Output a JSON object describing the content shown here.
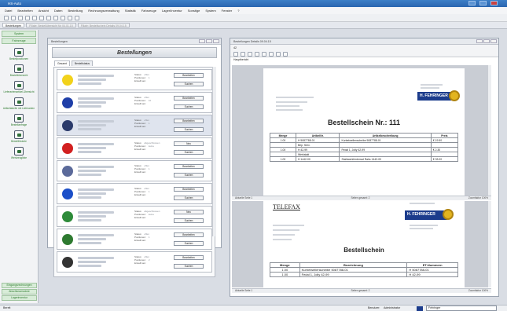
{
  "app": {
    "title": "HS-Auto"
  },
  "menu": [
    "Datei",
    "Bearbeiten",
    "Ansicht",
    "Daten",
    "Bestellung",
    "Rechnungsverwaltung",
    "Statistik",
    "Fahrzeuge",
    "Lager/Inventur",
    "Sonstige",
    "System",
    "Fenster",
    "?"
  ],
  "tabs": [
    {
      "label": "Bestellungen"
    },
    {
      "label": "Filiale: Bestellübersicht für 04.01.15"
    },
    {
      "label": "Filiale: Bestellschein Details 09.04.15"
    }
  ],
  "sidebar": {
    "header_top": "System",
    "header_second": "Fahrzeuge",
    "items": [
      {
        "label": "Bestellpositionen",
        "icon": "list-icon"
      },
      {
        "label": "Bestellübersicht",
        "icon": "clock-icon"
      },
      {
        "label": "Lieferantenartikel-Übersicht",
        "icon": "document-icon"
      },
      {
        "label": "Artikeltabelle mit Lieferanten",
        "icon": "tools-icon"
      },
      {
        "label": "Bestellanfrage",
        "icon": "globe-icon"
      },
      {
        "label": "Bestellhistorie",
        "icon": "tools-icon"
      },
      {
        "label": "Werkzeugliste",
        "icon": "gear-icon"
      }
    ],
    "bottom": [
      "Eingangsrechnungen",
      "Abschlussmodule",
      "Lagerinventur"
    ]
  },
  "bestellungen_window": {
    "title": "Bestellungen",
    "heading": "Bestellungen",
    "inner_tabs": [
      "Gesamt",
      "Bestellstatus"
    ],
    "field_labels": {
      "status": "Status:",
      "positionen": "Positionen:",
      "erstellt": "Erstellt am:"
    },
    "rows": [
      {
        "logo_color": "#f2d21b",
        "status": "offen",
        "positionen": "1",
        "btn1": "Bearbeiten",
        "btn2": "Suchen"
      },
      {
        "logo_color": "#1f3fa8",
        "status": "offen",
        "positionen": "10",
        "btn1": "Bearbeiten",
        "btn2": "Suchen"
      },
      {
        "logo_color": "#2b3b6b",
        "status": "offen",
        "positionen": "1",
        "btn1": "Bearbeiten",
        "btn2": "Suchen"
      },
      {
        "logo_color": "#d22020",
        "status": "abgeschlossen",
        "positionen": "keine",
        "btn1": "Neu",
        "btn2": "Suchen"
      },
      {
        "logo_color": "#5b6a9a",
        "status": "offen",
        "positionen": "1",
        "btn1": "Bearbeiten",
        "btn2": "Suchen"
      },
      {
        "logo_color": "#1b4fc8",
        "status": "offen",
        "positionen": "1",
        "btn1": "Bearbeiten",
        "btn2": "Suchen"
      },
      {
        "logo_color": "#2e8b3a",
        "status": "abgeschlossen",
        "positionen": "keine",
        "btn1": "Neu",
        "btn2": "Suchen"
      },
      {
        "logo_color": "#2e7a30",
        "status": "offen",
        "positionen": "1",
        "btn1": "Bearbeiten",
        "btn2": "Suchen"
      },
      {
        "logo_color": "#333333",
        "status": "offen",
        "positionen": "2",
        "btn1": "Bearbeiten",
        "btn2": "Suchen"
      }
    ]
  },
  "details_window": {
    "title": "Bestellungen Details 09.04.15",
    "toolbar_label": "42",
    "doc_tab": "Hauptbericht",
    "page1": {
      "heading": "Bestellschein Nr.: 111",
      "company": "H. FEHRINGER",
      "columns": [
        "Menge",
        "ArtikelNr.",
        "Artikelbeschreibung",
        "Preis"
      ],
      "rows": [
        [
          "1.00",
          "H 5087788-01",
          "Kurbelwellenscheibe 5087788-01",
          "€ 19.50"
        ],
        [
          "",
          "Bep. Serv.",
          "",
          ""
        ],
        [
          "1.00",
          "H 42-99",
          "Fedal 1, Jolly 42-99",
          "€ 2.30"
        ],
        [
          "",
          "Werkstatt",
          "",
          ""
        ],
        [
          "1.00",
          "H 1442-00",
          "Stahlwerkhinterrad Rahs 1442-00",
          "€ 33.00"
        ]
      ],
      "status_left": "Aktuelle Seite 1",
      "status_mid": "Seiten gesamt: 2",
      "status_right": "Zoomfaktor 100%"
    },
    "page2": {
      "fax": "TELEFAX",
      "company": "H. FEHRINGER",
      "heading": "Bestellschein",
      "columns": [
        "Menge",
        "Bezeichnung",
        "ET-Nummern"
      ],
      "rows": [
        [
          "1.00",
          "Kurbelwellenscheibe 5087788-01",
          "H 5087788-01"
        ],
        [
          "1.00",
          "Fedal 1, Jolly 42-99",
          "H 42-99"
        ]
      ],
      "status_left": "Aktuelle Seite 1",
      "status_mid": "Seiten gesamt: 2",
      "status_right": "Zoomfaktor 100%"
    }
  },
  "statusbar": {
    "left": "Bereit",
    "user_label": "Benutzer:",
    "user": "Administrator",
    "company": "Fehringer"
  }
}
